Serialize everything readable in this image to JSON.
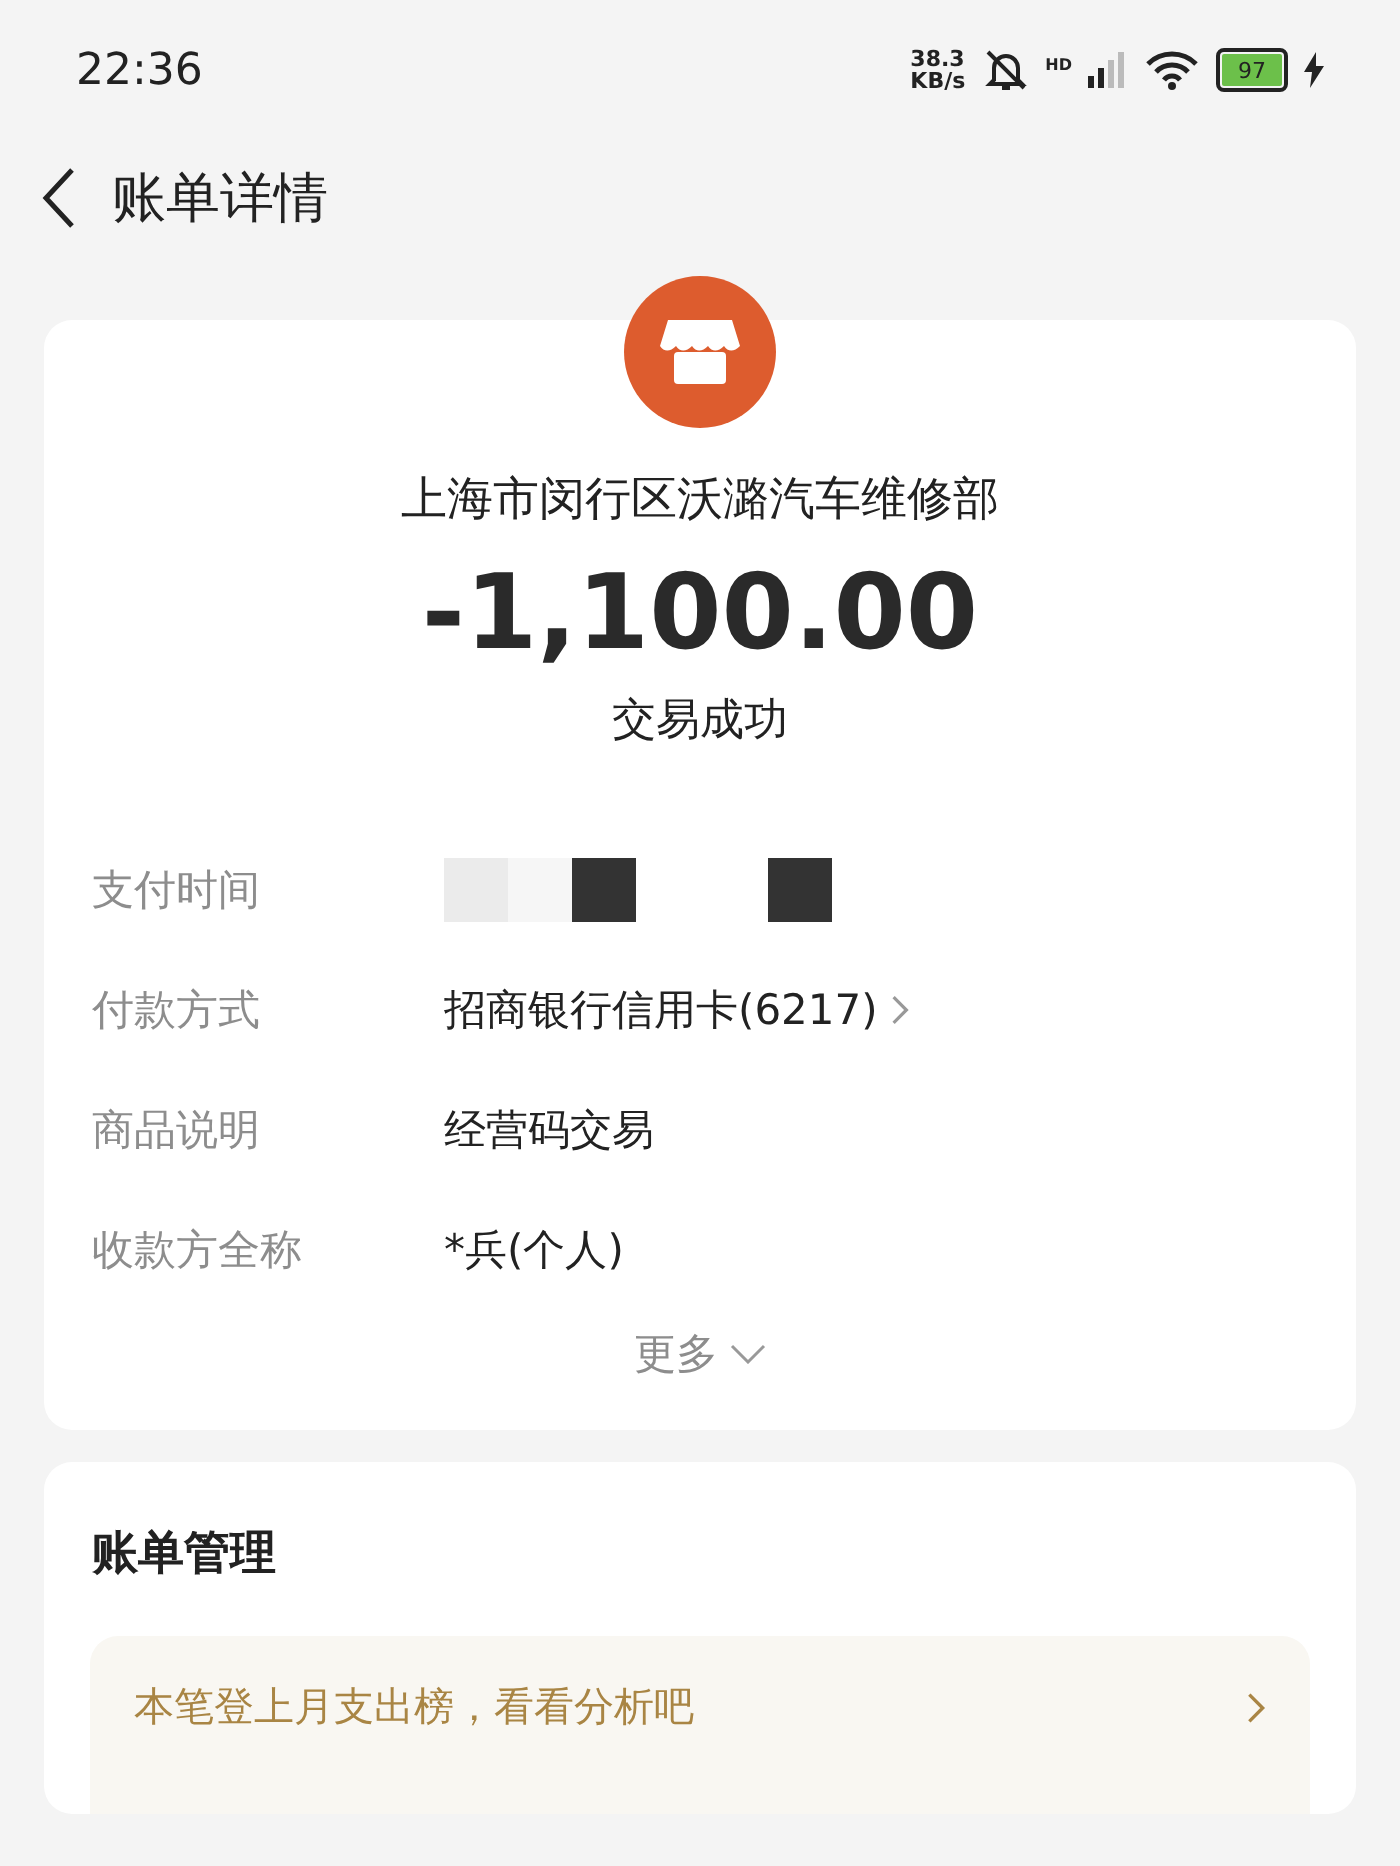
{
  "status_bar": {
    "time": "22:36",
    "speed_value": "38.3",
    "speed_unit": "KB/s",
    "network": "HD",
    "battery": "97"
  },
  "header": {
    "title": "账单详情"
  },
  "bill": {
    "merchant": "上海市闵行区沃潞汽车维修部",
    "amount": "-1,100.00",
    "status": "交易成功",
    "rows": [
      {
        "label": "支付时间",
        "kind": "redacted"
      },
      {
        "label": "付款方式",
        "kind": "link",
        "value": "招商银行信用卡(6217)"
      },
      {
        "label": "商品说明",
        "kind": "text",
        "value": "经营码交易"
      },
      {
        "label": "收款方全称",
        "kind": "text",
        "value": "*兵(个人)"
      }
    ],
    "more": "更多"
  },
  "management": {
    "title": "账单管理",
    "banner": "本笔登上月支出榜，看看分析吧"
  }
}
